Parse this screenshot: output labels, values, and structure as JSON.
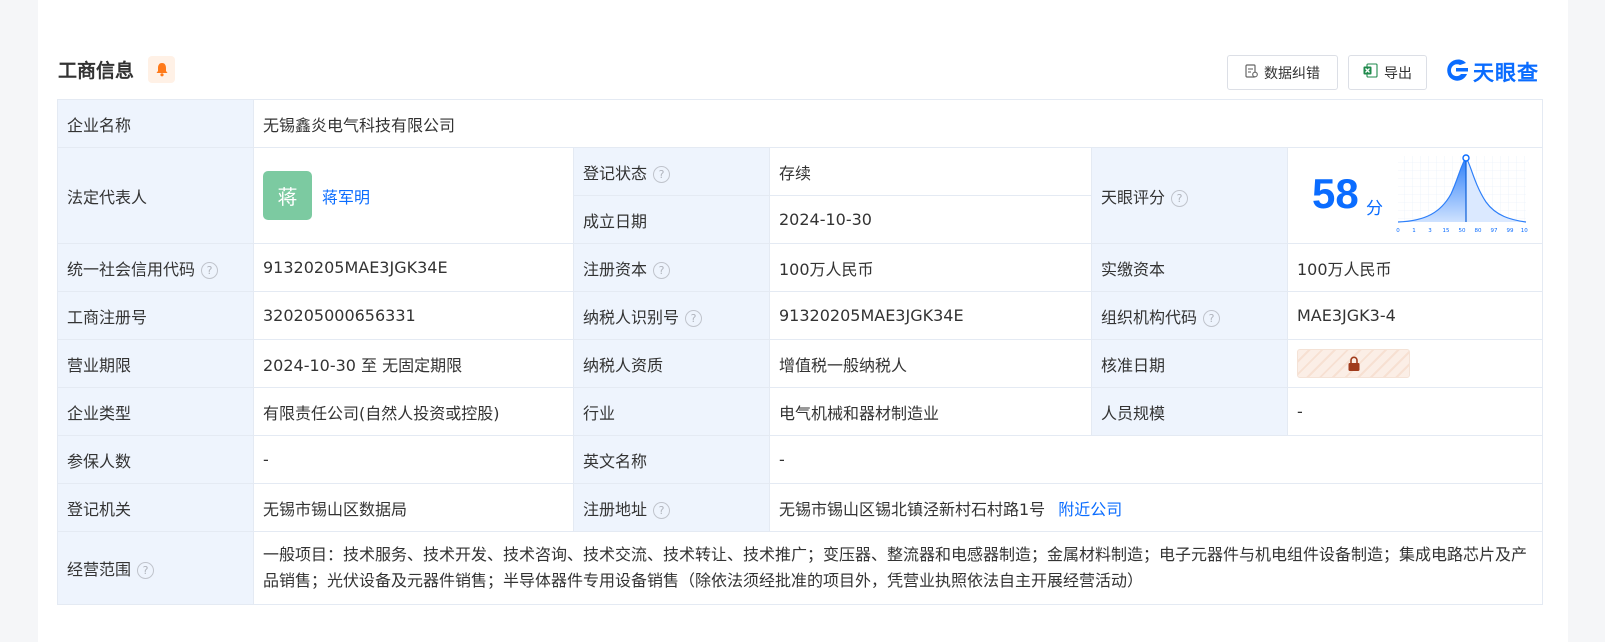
{
  "header": {
    "title": "工商信息",
    "correct_label": "数据纠错",
    "export_label": "导出",
    "logo_text": "天眼查"
  },
  "company": {
    "name_label": "企业名称",
    "name": "无锡鑫炎电气科技有限公司",
    "legal_rep_label": "法定代表人",
    "legal_rep_avatar": "蒋",
    "legal_rep": "蒋军明",
    "reg_status_label": "登记状态",
    "reg_status": "存续",
    "established_label": "成立日期",
    "established": "2024-10-30",
    "score_label": "天眼评分",
    "score": "58",
    "score_unit": "分",
    "credit_code_label": "统一社会信用代码",
    "credit_code": "91320205MAE3JGK34E",
    "reg_capital_label": "注册资本",
    "reg_capital": "100万人民币",
    "paid_capital_label": "实缴资本",
    "paid_capital": "100万人民币",
    "reg_no_label": "工商注册号",
    "reg_no": "320205000656331",
    "taxpayer_id_label": "纳税人识别号",
    "taxpayer_id": "91320205MAE3JGK34E",
    "org_code_label": "组织机构代码",
    "org_code": "MAE3JGK3-4",
    "term_label": "营业期限",
    "term": "2024-10-30 至 无固定期限",
    "taxpayer_type_label": "纳税人资质",
    "taxpayer_type": "增值税一般纳税人",
    "approval_date_label": "核准日期",
    "type_label": "企业类型",
    "type": "有限责任公司(自然人投资或控股)",
    "industry_label": "行业",
    "industry": "电气机械和器材制造业",
    "staff_size_label": "人员规模",
    "staff_size": "-",
    "insured_label": "参保人数",
    "insured": "-",
    "english_name_label": "英文名称",
    "english_name": "-",
    "authority_label": "登记机关",
    "authority": "无锡市锡山区数据局",
    "address_label": "注册地址",
    "address": "无锡市锡山区锡北镇泾新村石村路1号",
    "nearby_label": "附近公司",
    "scope_label": "经营范围",
    "scope": "一般项目：技术服务、技术开发、技术咨询、技术交流、技术转让、技术推广；变压器、整流器和电感器制造；金属材料制造；电子元器件与机电组件设备制造；集成电路芯片及产品销售；光伏设备及元器件销售；半导体器件专用设备销售（除依法须经批准的项目外，凭营业执照依法自主开展经营活动）"
  },
  "score_chart": {
    "x_ticks": [
      "0",
      "1",
      "3",
      "15",
      "50",
      "80",
      "97",
      "99",
      "100"
    ],
    "marker_value": 58
  },
  "colors": {
    "accent": "#0a6cff",
    "status_green": "#1a9f4e",
    "label_bg": "#eef4fd"
  },
  "icons": [
    "bell-icon",
    "document-icon",
    "excel-icon",
    "tianyancha-logo-icon",
    "question-icon",
    "lock-icon"
  ]
}
